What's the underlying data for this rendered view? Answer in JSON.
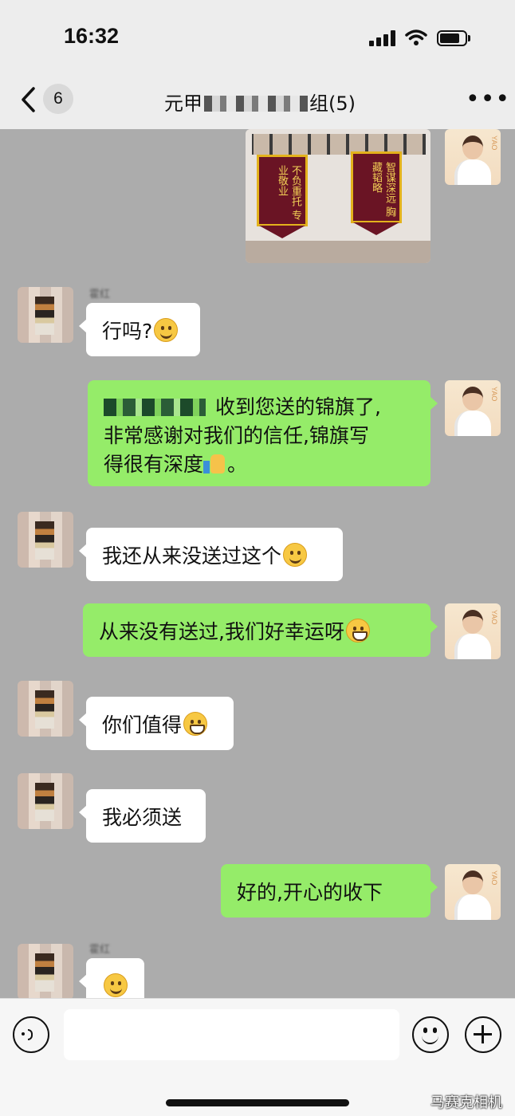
{
  "status": {
    "time": "16:32"
  },
  "header": {
    "back_count": "6",
    "title_start": "元甲",
    "title_end": "组(5)",
    "more": "•••"
  },
  "chat": {
    "photo_pennants": [
      {
        "text": "不负重托 专业敬业"
      },
      {
        "text": "智谋深远 胸藏韬略"
      }
    ],
    "messages": [
      {
        "from": "other",
        "sender": "霍红",
        "text": "行吗?",
        "emoji": "thinking-face"
      },
      {
        "from": "self",
        "line1": "收到您送的锦旗了,",
        "line2": "非常感谢对我们的信任,锦旗写",
        "line3": "得很有深度",
        "emoji": "thumbs-up",
        "tail": "。"
      },
      {
        "from": "other",
        "text": "我还从来没送过这个",
        "emoji": "laughing-crying-face"
      },
      {
        "from": "self",
        "text": "从来没有送过,我们好幸运呀",
        "emoji": "grinning-face"
      },
      {
        "from": "other",
        "text": "你们值得",
        "emoji": "grinning-face"
      },
      {
        "from": "other",
        "text": "我必须送"
      },
      {
        "from": "self",
        "text": "好的,开心的收下"
      },
      {
        "from": "other",
        "sender": "霍红",
        "text": "",
        "emoji": "smiling-face"
      }
    ]
  },
  "input": {
    "value": "",
    "placeholder": ""
  },
  "watermark": "马赛克相机",
  "colors": {
    "self_bubble": "#95ec69",
    "other_bubble": "#ffffff",
    "chat_bg": "#acacac"
  }
}
